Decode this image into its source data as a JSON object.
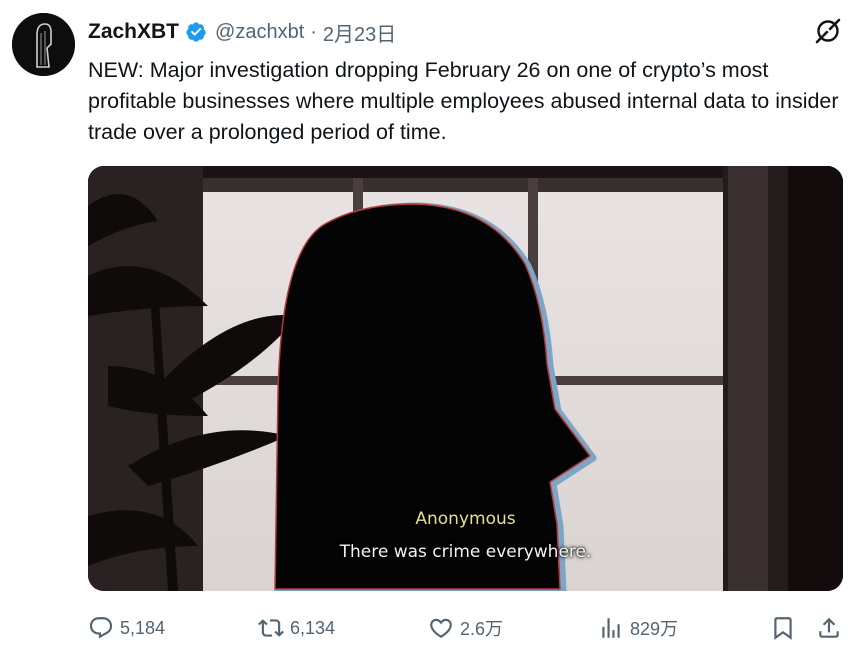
{
  "author": {
    "name": "ZachXBT",
    "handle": "@zachxbt",
    "separator": "·",
    "date": "2月23日"
  },
  "icons": {
    "verified": "verified-badge-icon",
    "grok": "grok-icon",
    "reply": "reply-icon",
    "repost": "repost-icon",
    "like": "heart-icon",
    "views": "views-icon",
    "bookmark": "bookmark-icon",
    "share": "share-icon"
  },
  "colors": {
    "verified": "#1d9bf0",
    "text": "#0f1419",
    "secondary": "#536471"
  },
  "tweet": {
    "text": "NEW: Major investigation dropping February 26 on one of crypto’s most profitable businesses where multiple employees abused internal data to insider trade over a prolonged period of time."
  },
  "media": {
    "caption_label": "Anonymous",
    "caption_text": "There was crime everywhere."
  },
  "actions": {
    "replies": "5,184",
    "reposts": "6,134",
    "likes": "2.6万",
    "views": "829万"
  }
}
